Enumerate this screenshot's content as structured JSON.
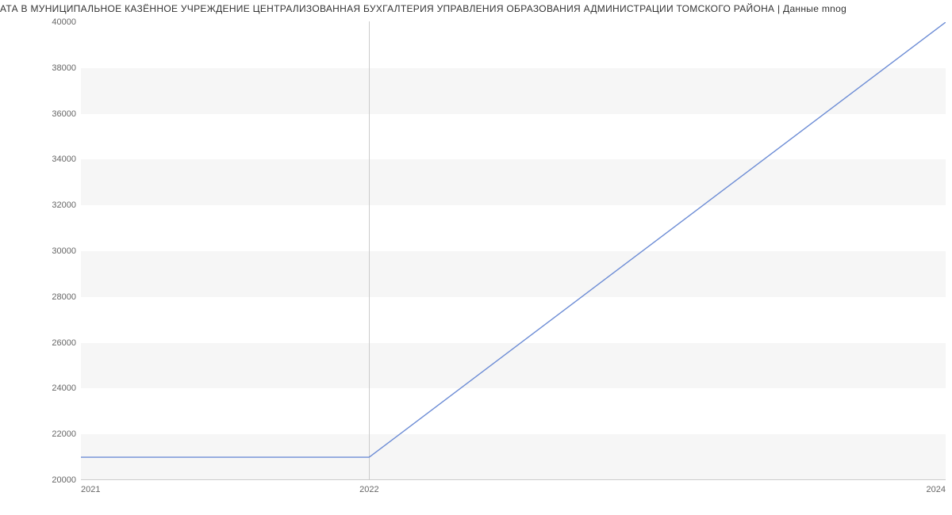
{
  "chart_data": {
    "type": "line",
    "title": "АТА В МУНИЦИПАЛЬНОЕ КАЗЁННОЕ УЧРЕЖДЕНИЕ ЦЕНТРАЛИЗОВАННАЯ БУХГАЛТЕРИЯ УПРАВЛЕНИЯ ОБРАЗОВАНИЯ АДМИНИСТРАЦИИ ТОМСКОГО РАЙОНА | Данные mnog",
    "x": [
      2021,
      2022,
      2024
    ],
    "values": [
      21000,
      21000,
      40000
    ],
    "xlabel": "",
    "ylabel": "",
    "ylim": [
      20000,
      40000
    ],
    "xlim": [
      2021,
      2024
    ],
    "y_ticks": [
      20000,
      22000,
      24000,
      26000,
      28000,
      30000,
      32000,
      34000,
      36000,
      38000,
      40000
    ],
    "x_ticks": [
      2021,
      2022,
      2024
    ],
    "line_color": "#6C8CD5"
  }
}
